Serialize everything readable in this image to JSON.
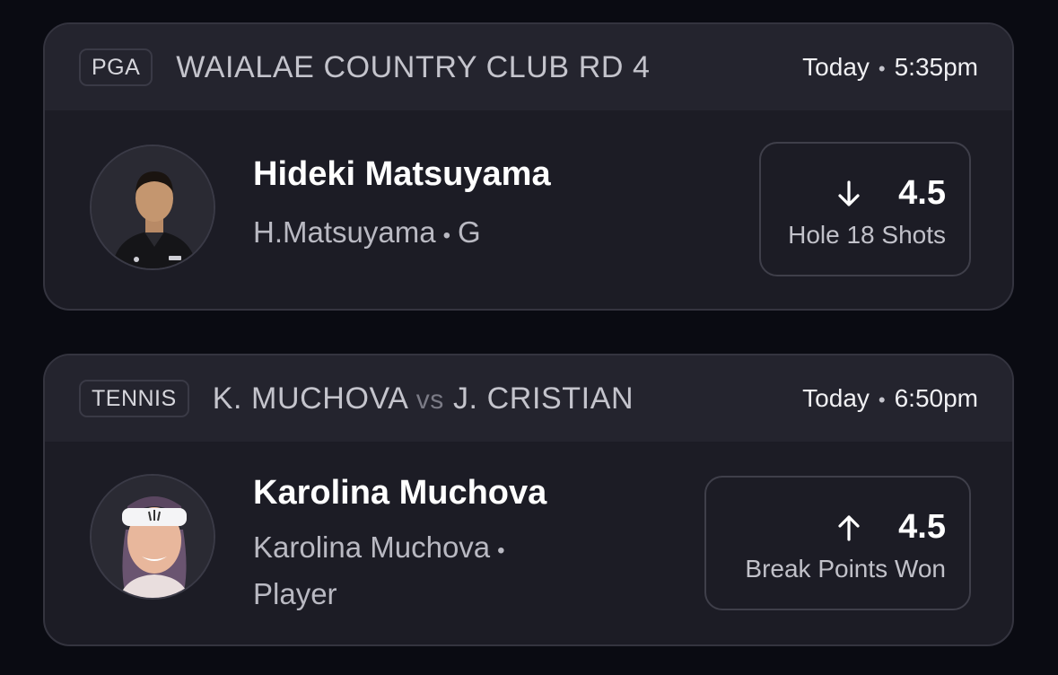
{
  "cards": [
    {
      "league": "PGA",
      "event_title": "WAIALAE COUNTRY CLUB RD 4",
      "day": "Today",
      "time": "5:35pm",
      "player_name": "Hideki Matsuyama",
      "player_short": "H.Matsuyama",
      "position": "G",
      "direction": "down",
      "line": "4.5",
      "stat": "Hole 18 Shots"
    },
    {
      "league": "TENNIS",
      "team_a": "K. MUCHOVA",
      "vs": "vs",
      "team_b": "J. CRISTIAN",
      "day": "Today",
      "time": "6:50pm",
      "player_name": "Karolina Muchova",
      "player_short": "Karolina Muchova",
      "position": "Player",
      "direction": "up",
      "line": "4.5",
      "stat": "Break Points Won"
    }
  ],
  "separator": "•",
  "icons": {
    "down": "arrow-down-icon",
    "up": "arrow-up-icon"
  }
}
